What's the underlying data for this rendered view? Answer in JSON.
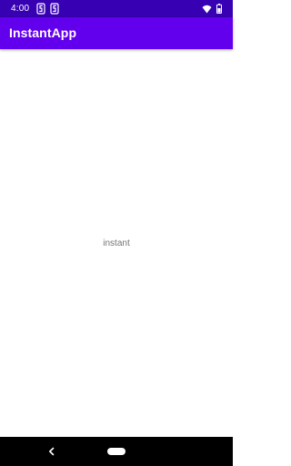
{
  "status_bar": {
    "time": "4:00",
    "left_icons": [
      "notification-s-icon",
      "notification-s-icon"
    ],
    "right_icons": [
      "wifi-icon",
      "battery-icon"
    ],
    "background": "#3700B3"
  },
  "app_bar": {
    "title": "InstantApp",
    "background": "#6200EE"
  },
  "content": {
    "text": "instant"
  },
  "navigation_bar": {
    "icons": [
      "back-icon",
      "home-pill"
    ],
    "background": "#000000"
  }
}
